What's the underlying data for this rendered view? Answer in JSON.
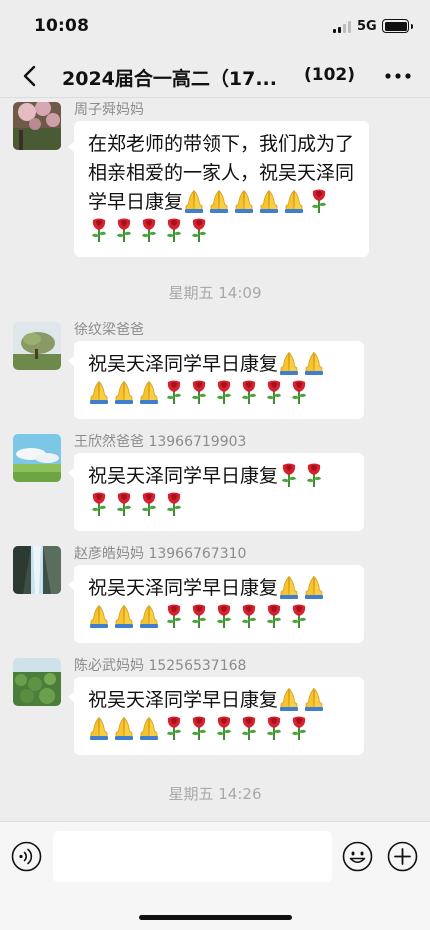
{
  "status_bar": {
    "time": "10:08",
    "network": "5G"
  },
  "nav": {
    "title": "2024届合一高二（17...",
    "member_count": "(102)"
  },
  "messages": [
    {
      "sender": "周子舜妈妈",
      "text": "在郑老师的带领下，我们成为了相亲相爱的一家人，祝吴天泽同学早日康复",
      "emojis": [
        "pray",
        "pray",
        "pray",
        "pray",
        "pray",
        "rose",
        "rose",
        "rose",
        "rose",
        "rose",
        "rose"
      ]
    },
    {
      "sender": "徐纹梁爸爸",
      "text": "祝吴天泽同学早日康复",
      "emojis": [
        "pray",
        "pray",
        "pray",
        "pray",
        "pray",
        "rose",
        "rose",
        "rose",
        "rose",
        "rose",
        "rose"
      ]
    },
    {
      "sender": "王欣然爸爸 13966719903",
      "text": "祝吴天泽同学早日康复",
      "emojis": [
        "rose",
        "rose",
        "rose",
        "rose",
        "rose",
        "rose"
      ]
    },
    {
      "sender": "赵彦皓妈妈 13966767310",
      "text": "祝吴天泽同学早日康复",
      "emojis": [
        "pray",
        "pray",
        "pray",
        "pray",
        "pray",
        "rose",
        "rose",
        "rose",
        "rose",
        "rose",
        "rose"
      ]
    },
    {
      "sender": "陈必武妈妈 15256537168",
      "text": "祝吴天泽同学早日康复",
      "emojis": [
        "pray",
        "pray",
        "pray",
        "pray",
        "pray",
        "rose",
        "rose",
        "rose",
        "rose",
        "rose",
        "rose"
      ]
    }
  ],
  "timestamps": [
    "星期五 14:09",
    "星期五 14:26"
  ],
  "input": {
    "value": ""
  }
}
